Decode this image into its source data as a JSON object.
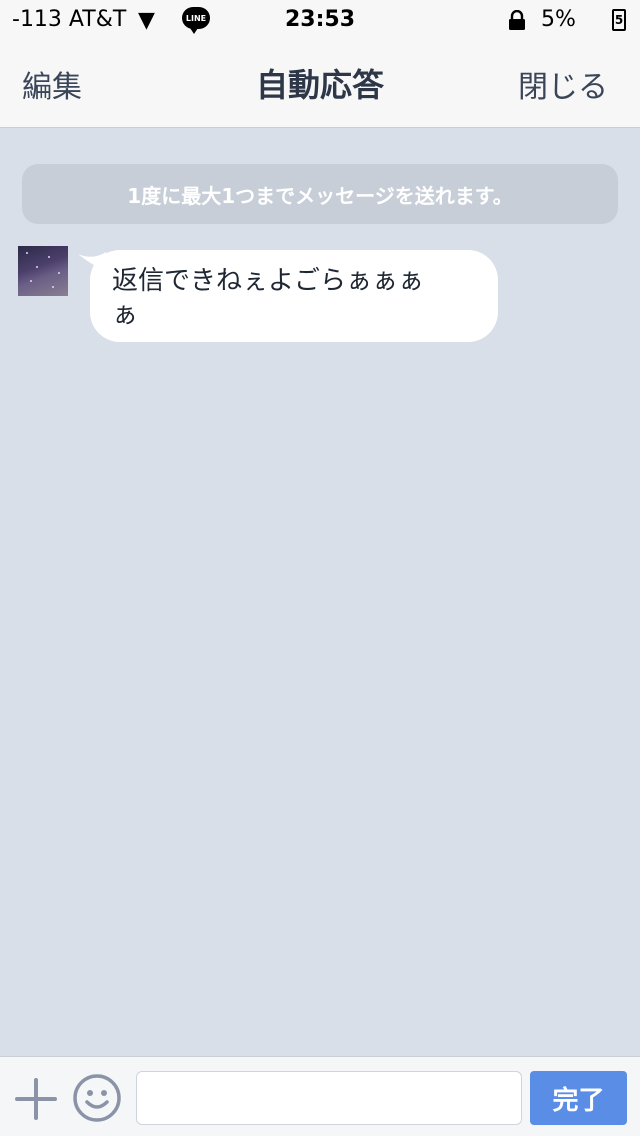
{
  "status_bar": {
    "carrier": "-113 AT&T",
    "time": "23:53",
    "battery_percent": "5%",
    "line_badge": "LINE",
    "battery_glyph": "5",
    "icons": [
      "signal-arrow-icon",
      "line-icon",
      "lock-icon",
      "battery-icon"
    ]
  },
  "nav": {
    "edit_label": "編集",
    "title": "自動応答",
    "close_label": "閉じる"
  },
  "chat": {
    "notice": "1度に最大1つまでメッセージを送れます。",
    "messages": [
      {
        "line1": "返信できねぇよごらぁぁぁ",
        "line2": "ぁ"
      }
    ]
  },
  "input_bar": {
    "placeholder": "",
    "value": "",
    "done_label": "完了"
  },
  "colors": {
    "background": "#d8dfe8",
    "accent": "#5a8ee6",
    "notice_bg": "#c8ced8"
  }
}
